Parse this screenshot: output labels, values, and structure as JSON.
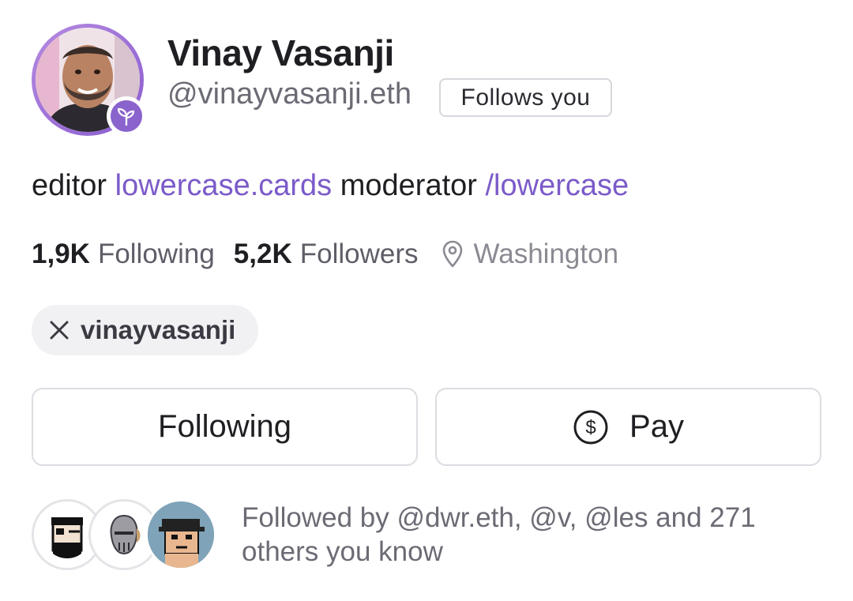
{
  "profile": {
    "display_name": "Vinay Vasanji",
    "username": "@vinayvasanji.eth",
    "follows_you_label": "Follows you",
    "bio": {
      "text1": "editor ",
      "link1": "lowercase.cards",
      "text2": " moderator ",
      "link2": "/lowercase"
    },
    "stats": {
      "following_count": "1,9K",
      "following_label": "Following",
      "followers_count": "5,2K",
      "followers_label": "Followers",
      "location": "Washington"
    },
    "social": {
      "x_handle": "vinayvasanji"
    },
    "buttons": {
      "following_label": "Following",
      "pay_label": "Pay"
    },
    "followed_by": {
      "text": "Followed by @dwr.eth, @v, @les and 271 others you know"
    }
  },
  "icons": {
    "badge": "sprout-icon",
    "location": "map-pin-icon",
    "social": "x-logo-icon",
    "pay": "dollar-circle-icon"
  },
  "colors": {
    "accent": "#7b5bc9",
    "badge": "#8b63cd",
    "muted": "#6b6b75"
  }
}
